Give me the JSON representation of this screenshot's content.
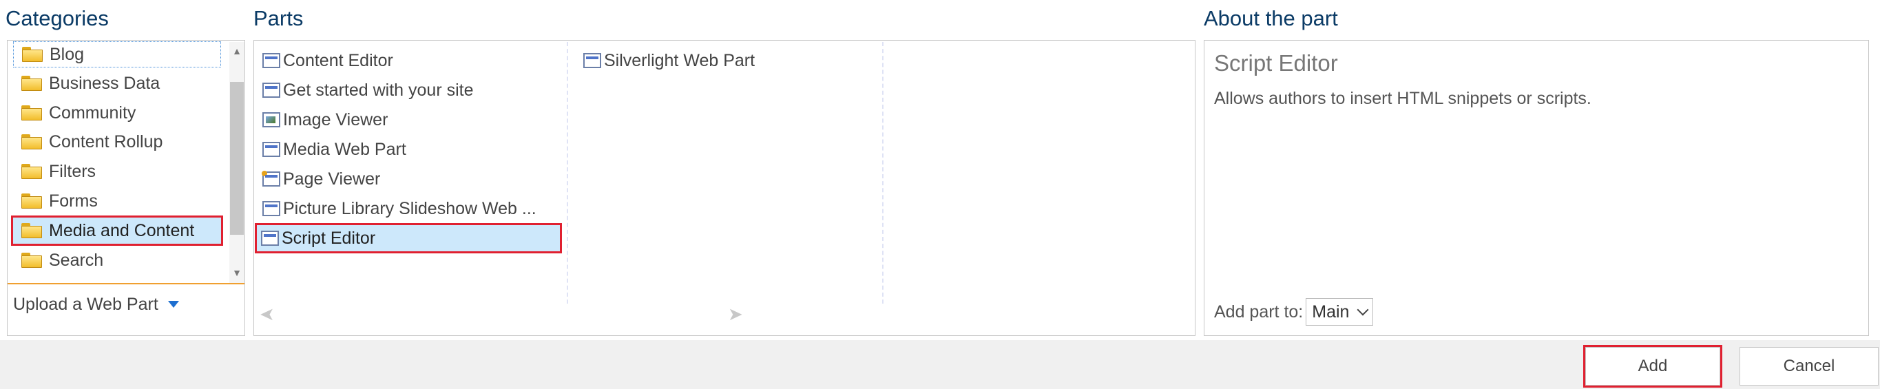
{
  "headings": {
    "categories": "Categories",
    "parts": "Parts",
    "about": "About the part"
  },
  "categories": {
    "items": [
      {
        "label": "Blog"
      },
      {
        "label": "Business Data"
      },
      {
        "label": "Community"
      },
      {
        "label": "Content Rollup"
      },
      {
        "label": "Filters"
      },
      {
        "label": "Forms"
      },
      {
        "label": "Media and Content"
      },
      {
        "label": "Search"
      }
    ],
    "selected": "Media and Content",
    "upload_label": "Upload a Web Part"
  },
  "parts": {
    "column1": [
      {
        "label": "Content Editor",
        "icon": "content-editor-icon"
      },
      {
        "label": "Get started with your site",
        "icon": "web-part-icon"
      },
      {
        "label": "Image Viewer",
        "icon": "image-viewer-icon"
      },
      {
        "label": "Media Web Part",
        "icon": "web-part-icon"
      },
      {
        "label": "Page Viewer",
        "icon": "page-viewer-icon"
      },
      {
        "label": "Picture Library Slideshow Web ...",
        "icon": "web-part-icon"
      },
      {
        "label": "Script Editor",
        "icon": "web-part-icon"
      }
    ],
    "column2": [
      {
        "label": "Silverlight Web Part",
        "icon": "web-part-icon"
      }
    ],
    "selected": "Script Editor"
  },
  "about": {
    "title": "Script Editor",
    "description": "Allows authors to insert HTML snippets or scripts.",
    "add_to_label": "Add part to:",
    "zone_value": "Main"
  },
  "footer": {
    "add_label": "Add",
    "cancel_label": "Cancel"
  },
  "colors": {
    "heading": "#0b3b66",
    "selection": "#cde8fb",
    "highlight_border": "#e02030"
  }
}
